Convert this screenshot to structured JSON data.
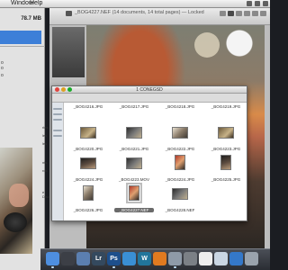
{
  "menubar": {
    "items": [
      "Window",
      "Help"
    ]
  },
  "left_panel": {
    "size_label": "78.7 MB",
    "list_text": [
      "o",
      "o",
      "o"
    ],
    "side_labels": [
      "ries",
      "les",
      "les",
      "nts",
      "rds",
      "e Disc"
    ]
  },
  "document": {
    "title": "_BOG4227.NEF (14 documents, 14 total pages) — Locked"
  },
  "finder": {
    "title": "1 CONEGSD",
    "files": [
      {
        "name": "_BOG4216.JPG",
        "kind": "land",
        "tone": "t-a"
      },
      {
        "name": "_BOG4217.JPG",
        "kind": "land",
        "tone": "t-b"
      },
      {
        "name": "_BOG4218.JPG",
        "kind": "land",
        "tone": "t-c"
      },
      {
        "name": "_BOG4219.JPG",
        "kind": "land",
        "tone": "t-d"
      },
      {
        "name": "_BOG4220.JPG",
        "kind": "land",
        "tone": "t-a"
      },
      {
        "name": "_BOG4221.JPG",
        "kind": "land",
        "tone": "t-b"
      },
      {
        "name": "_BOG4222.JPG",
        "kind": "land",
        "tone": "t-d"
      },
      {
        "name": "_BOG4223.JPG",
        "kind": "land",
        "tone": "t-a"
      },
      {
        "name": "_BOG4224.JPG",
        "kind": "land",
        "tone": "t-c"
      },
      {
        "name": "_BOG4223.MOV",
        "kind": "land",
        "tone": "t-b"
      },
      {
        "name": "_BOG4224.JPG",
        "kind": "port",
        "tone": "t-e"
      },
      {
        "name": "_BOG4225.JPG",
        "kind": "port",
        "tone": "t-c"
      },
      {
        "name": "_BOG4226.JPG",
        "kind": "port",
        "tone": "t-d"
      },
      {
        "name": "_BOG4227.NEF",
        "kind": "port",
        "tone": "t-e"
      },
      {
        "name": "_BOG4228.NEF",
        "kind": "land",
        "tone": "t-b"
      }
    ]
  },
  "dock": {
    "icons": [
      {
        "name": "finder",
        "label": "",
        "color": "#4e8fe0"
      },
      {
        "name": "mission-control",
        "label": "",
        "color": "#3c3f46"
      },
      {
        "name": "iphoto",
        "label": "",
        "color": "#5b7fb0"
      },
      {
        "name": "lightroom",
        "label": "Lr",
        "color": "#34495e"
      },
      {
        "name": "photoshop",
        "label": "Ps",
        "color": "#1d4f8c"
      },
      {
        "name": "safari",
        "label": "",
        "color": "#3a8fd4"
      },
      {
        "name": "wordpress",
        "label": "W",
        "color": "#21759b"
      },
      {
        "name": "firefox",
        "label": "",
        "color": "#e07a20"
      },
      {
        "name": "preview",
        "label": "",
        "color": "#8e9aa8"
      },
      {
        "name": "system-preferences",
        "label": "",
        "color": "#7b8086"
      },
      {
        "name": "calendar",
        "label": "",
        "color": "#eeeeee"
      },
      {
        "name": "mail",
        "label": "",
        "color": "#c9d6e3"
      },
      {
        "name": "app-store",
        "label": "",
        "color": "#3478c9"
      },
      {
        "name": "trash",
        "label": "",
        "color": "#9aa3ad"
      }
    ]
  }
}
